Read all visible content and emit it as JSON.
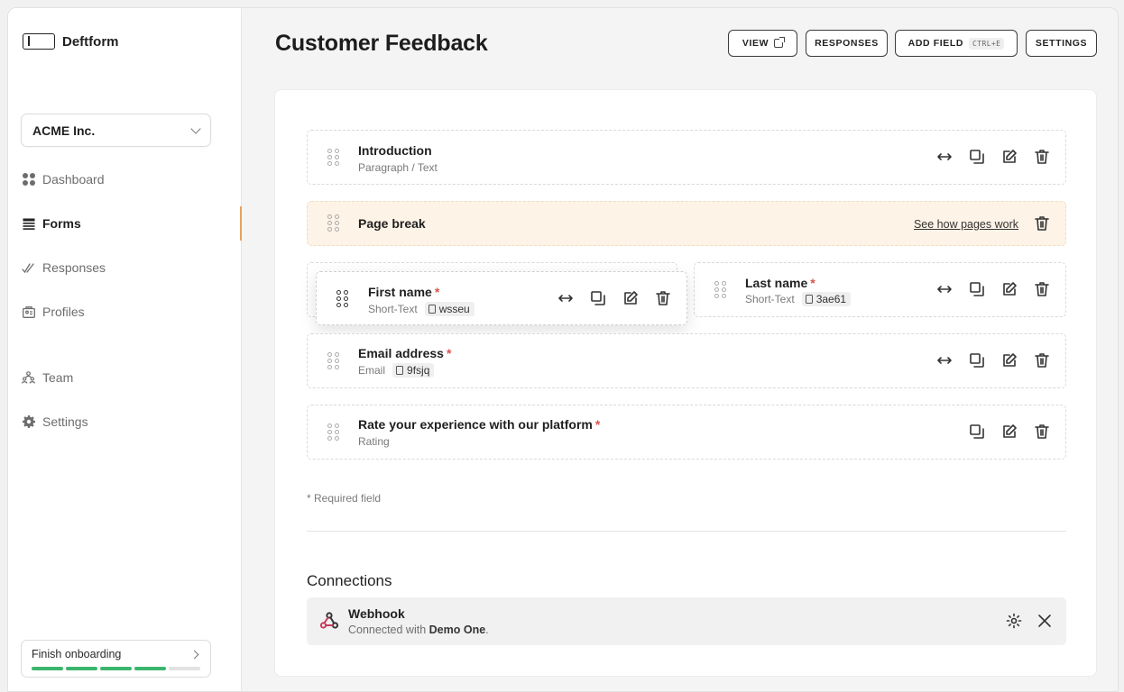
{
  "app": {
    "name": "Deftform"
  },
  "sidebar": {
    "org": "ACME Inc.",
    "items": [
      {
        "label": "Dashboard",
        "icon": "dashboard-icon"
      },
      {
        "label": "Forms",
        "icon": "forms-icon",
        "active": true
      },
      {
        "label": "Responses",
        "icon": "responses-icon"
      },
      {
        "label": "Profiles",
        "icon": "profiles-icon"
      },
      {
        "label": "Team",
        "icon": "team-icon"
      },
      {
        "label": "Settings",
        "icon": "gear-icon"
      }
    ],
    "onboarding": {
      "label": "Finish onboarding",
      "steps_done": 4,
      "steps_total": 5
    }
  },
  "header": {
    "title": "Customer Feedback",
    "buttons": {
      "view": "VIEW",
      "responses": "RESPONSES",
      "add_field": "ADD FIELD",
      "add_field_shortcut": "CTRL+E",
      "settings": "SETTINGS"
    }
  },
  "fields": {
    "introduction": {
      "title": "Introduction",
      "type": "Paragraph / Text"
    },
    "page_break": {
      "title": "Page break",
      "link": "See how pages work"
    },
    "first_name": {
      "title": "First name",
      "type": "Short-Text",
      "id": "wsseu",
      "required": "*"
    },
    "last_name": {
      "title": "Last name",
      "type": "Short-Text",
      "id": "3ae61",
      "required": "*"
    },
    "email": {
      "title": "Email address",
      "type": "Email",
      "id": "9fsjq",
      "required": "*"
    },
    "rating": {
      "title": "Rate your experience with our platform",
      "type": "Rating",
      "required": "*"
    }
  },
  "required_note": "* Required field",
  "connections": {
    "title": "Connections",
    "items": [
      {
        "name": "Webhook",
        "desc_prefix": "Connected with",
        "desc_target": "Demo One",
        "desc_suffix": "."
      }
    ]
  },
  "colors": {
    "accent": "#e8a15b",
    "progress_done": "#3bb56c",
    "progress_todo": "#e2e2e2",
    "page_break_bg": "#fdf3e6",
    "required": "#d9534f"
  }
}
